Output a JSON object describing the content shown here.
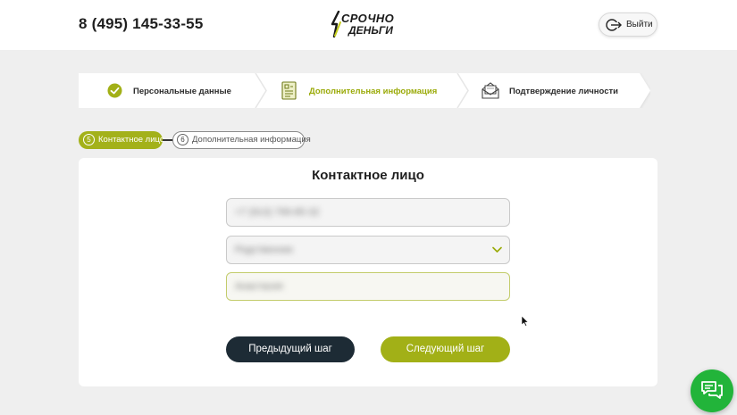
{
  "header": {
    "phone": "8 (495) 145-33-55",
    "logo": {
      "line1": "СРОЧНО",
      "line2": "ДЕНЬГИ",
      "icon": "lightning-logo-icon"
    },
    "logout_label": "Выйти",
    "logout_icon": "logout-icon"
  },
  "steps": [
    {
      "label": "Персональные данные",
      "icon": "check-circle-icon",
      "state": "done"
    },
    {
      "label": "Дополнительная информация",
      "icon": "document-form-icon",
      "state": "active"
    },
    {
      "label": "Подтверждение личности",
      "icon": "envelope-icon",
      "state": "pending"
    }
  ],
  "substeps": [
    {
      "number": "5",
      "label": "Контактное лицо",
      "state": "active"
    },
    {
      "number": "6",
      "label": "Дополнительная информация",
      "state": "pending"
    }
  ],
  "form": {
    "title": "Контактное лицо",
    "phone_value": "+7 (913) 799-85-32",
    "relation_value": "Родственник",
    "name_value": "Анастасия"
  },
  "buttons": {
    "prev": "Предыдущий шаг",
    "next": "Следующий шаг"
  },
  "colors": {
    "accent": "#a2b017",
    "dark_button": "#1d2b35",
    "chat": "#22b43a"
  },
  "chat_icon": "chat-bubbles-icon"
}
